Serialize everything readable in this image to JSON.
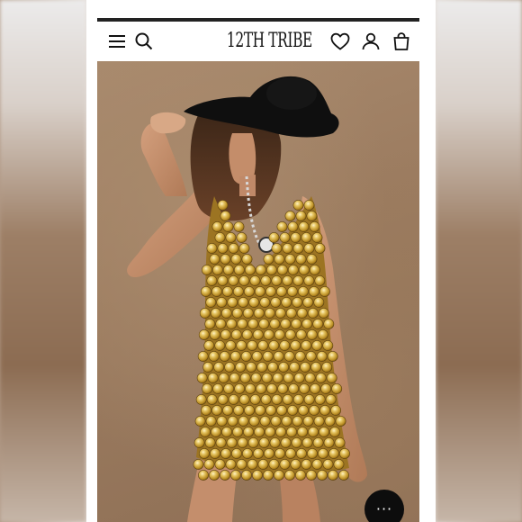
{
  "header": {
    "brand": "12TH TRIBE",
    "icons": [
      "menu-icon",
      "search-icon",
      "heart-icon",
      "account-icon",
      "bag-icon"
    ]
  },
  "chat": {
    "icon": "chat-icon",
    "dots": "···"
  },
  "colors": {
    "header_bg": "#ffffff",
    "photo_bg": "#9c7c60",
    "dress_gold": "#c9a23a",
    "hat": "#111111",
    "chat_button": "#0d0d0d"
  }
}
